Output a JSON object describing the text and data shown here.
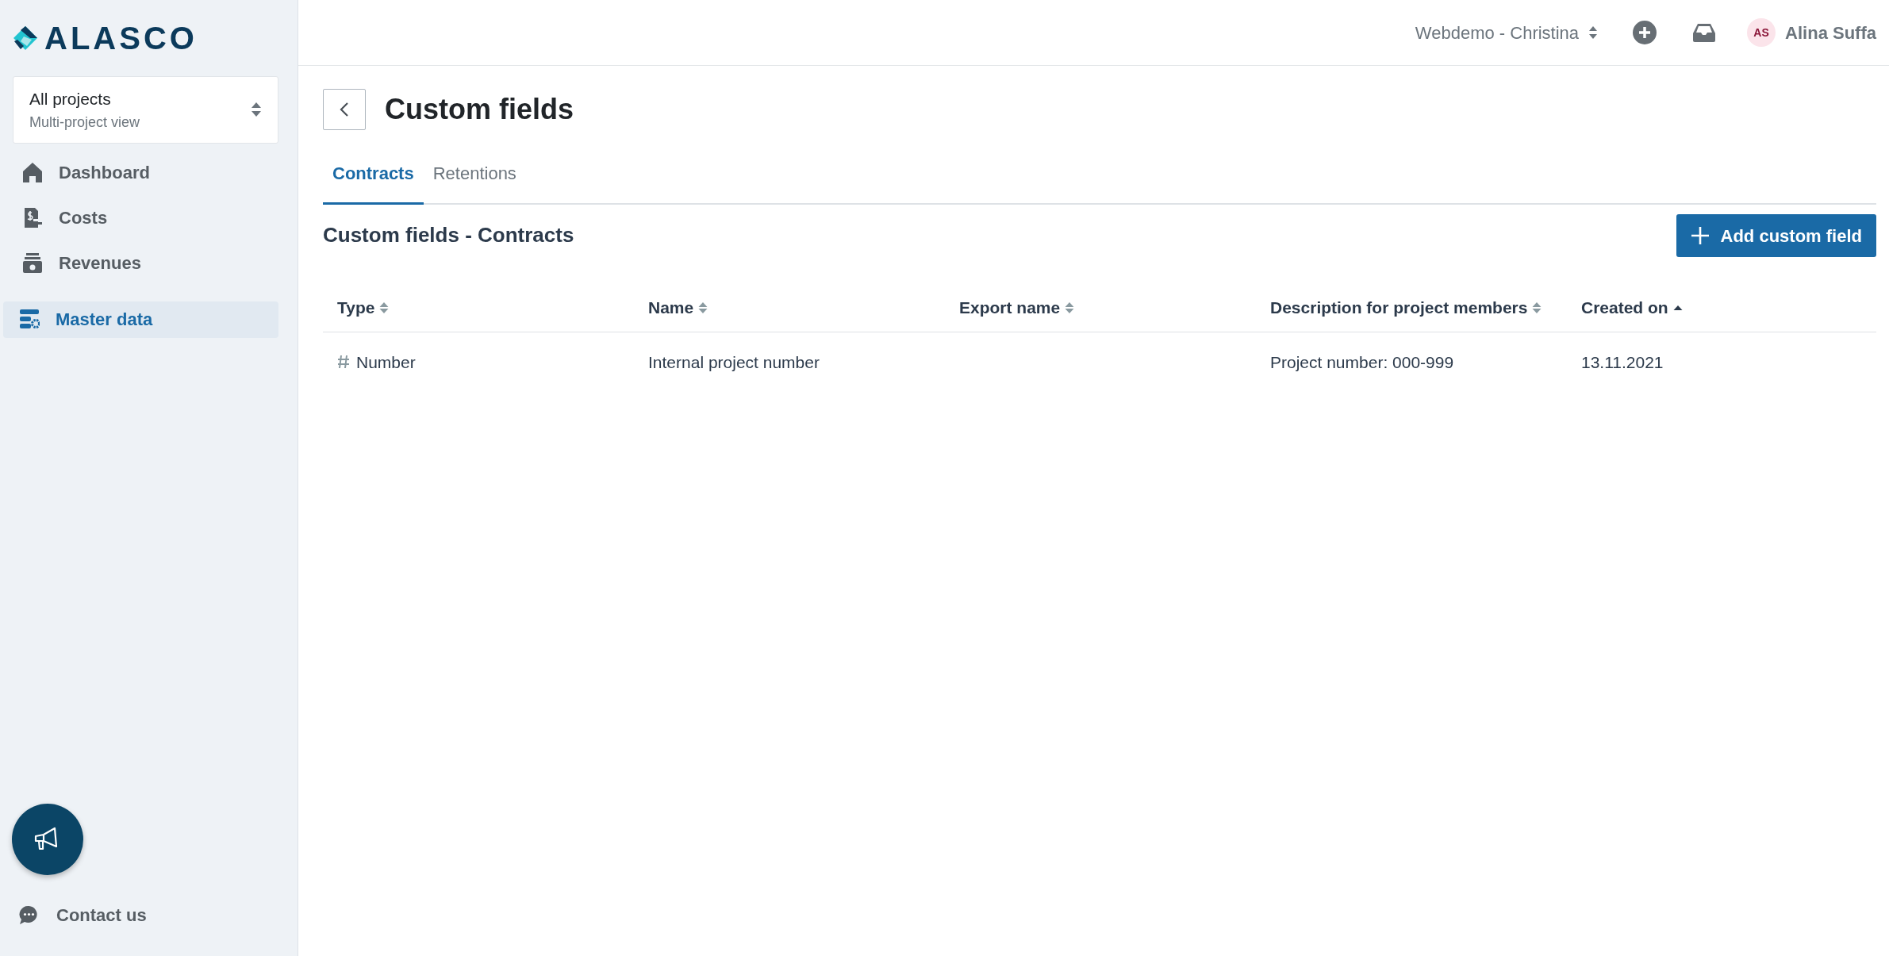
{
  "sidebar": {
    "logo": "ALASCO",
    "project_selector": {
      "title": "All projects",
      "subtitle": "Multi-project view"
    },
    "nav_items": [
      {
        "label": "Dashboard",
        "selected": false
      },
      {
        "label": "Costs",
        "selected": false
      },
      {
        "label": "Revenues",
        "selected": false
      },
      {
        "label": "Master data",
        "selected": true
      }
    ],
    "contact": {
      "label": "Contact us"
    }
  },
  "header": {
    "workspace": "Webdemo - Christina",
    "user": {
      "initials": "AS",
      "name": "Alina Suffa"
    }
  },
  "page": {
    "title": "Custom fields",
    "tabs": [
      {
        "label": "Contracts",
        "selected": true
      },
      {
        "label": "Retentions",
        "selected": false
      }
    ],
    "section_title": "Custom fields - Contracts",
    "add_button": "Add custom field",
    "table": {
      "columns": [
        {
          "label": "Type",
          "sorted": false
        },
        {
          "label": "Name",
          "sorted": false
        },
        {
          "label": "Export name",
          "sorted": false
        },
        {
          "label": "Description for project members",
          "sorted": false
        },
        {
          "label": "Created on",
          "sorted": true
        }
      ],
      "rows": [
        {
          "type": "Number",
          "name": "Internal project number",
          "description": "Project number: 000-999",
          "created_on": "13.11.2021"
        }
      ]
    }
  }
}
